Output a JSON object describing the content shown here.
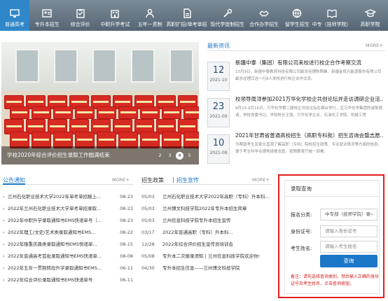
{
  "nav": {
    "items": [
      {
        "label": "普通高考",
        "icon": "monitor-icon",
        "active": true
      },
      {
        "label": "专升本招生",
        "icon": "id-card-icon"
      },
      {
        "label": "综合评价",
        "icon": "clipboard-icon"
      },
      {
        "label": "中职升学考试",
        "icon": "building-icon"
      },
      {
        "label": "五年一贯制",
        "icon": "person-icon"
      },
      {
        "label": "高职扩招/单考单招",
        "icon": "document-icon"
      },
      {
        "label": "现代学徒制招生",
        "icon": "tools-icon"
      },
      {
        "label": "合作办学招生",
        "icon": "handshake-icon"
      },
      {
        "label": "留学生招生",
        "icon": "globe-icon"
      },
      {
        "label": "中专（技师学院）",
        "icon": "book-icon"
      },
      {
        "label": "高职学院",
        "icon": "graduation-cap-icon"
      }
    ]
  },
  "banner": {
    "caption": "学校2020年综合评价招生录取工作圆满结束",
    "pages": [
      "2",
      "3",
      "4",
      "5"
    ],
    "active_page": "4"
  },
  "latest": {
    "title": "最新资讯",
    "more": "MORE+",
    "items": [
      {
        "day": "12",
        "ym": "2021-10",
        "title": "新疆中泰（集团）有限公司来校进行校企合作考察交流",
        "desc": "10月9日，新疆中泰教育科技有限公司副总经理陈照峰、新疆金辉光能源股份有限公司副总经理闫洁一行8人来校进行校企合作交流。"
      },
      {
        "day": "23",
        "ym": "2021-09",
        "title": "校领导周浔参加2021万华化学校企共创论坛并走访调研企业活...",
        "desc": "9月15-9月16日，万华化学第二届校企共创论坛在烟台举行，应万华化学集团的诚挚邀请，学校党委书记、学校校长王强、万华化学企业，石油化工学院、机械工程"
      },
      {
        "day": "10",
        "ym": "2021-08",
        "title": "2021年甘肃省普通高校招生（高职专科批）招生咨询会暨志愿...",
        "desc": "为帮助考生及家长直观了解高职（专科）院校招生政策、专业就业情况等方面的信息，便于考生科学合理地填报志愿。按照教育厅统一部署，"
      }
    ]
  },
  "notice": {
    "title": "公告通知",
    "more": "MORE+",
    "rows": [
      {
        "text": "兰州石化职业技术大学2022年单考单招报上...",
        "date": "08-23"
      },
      {
        "text": "2022年兰州石化职业技术大学单考单招录取...",
        "date": "08-23"
      },
      {
        "text": "2022年中职升学录取通知书EMS快递单号（...",
        "date": "08-23"
      },
      {
        "text": "2022年理工/文史/艺术类录取通知书EMS...",
        "date": "08-22"
      },
      {
        "text": "2022年隆重庆典类录取通知书EMS快递单...",
        "date": "08-15"
      },
      {
        "text": "2022年普通高考首批录取通知书EMS快递单...",
        "date": "08-08"
      },
      {
        "text": "2022年五年一贯制转段升学录取通知书EMS...",
        "date": "06-11"
      },
      {
        "text": "2022年综合评价录取通知书EMS快递单号",
        "date": "06-11"
      }
    ]
  },
  "policy": {
    "tab1": "招生政策",
    "tab2": "招生宣传",
    "more": "MORE+",
    "rows": [
      {
        "date": "05/03",
        "text": "兰州石化职业技术大学2022年高职（专科）升本科..."
      },
      {
        "date": "05/03",
        "text": "兰州博文科技学院2022年专升本招生简章"
      },
      {
        "date": "05/03",
        "text": "兰州信息科技学院专升本招生宣传"
      },
      {
        "date": "03/17",
        "text": "2022年普通高职（专科）升本科..."
      },
      {
        "date": "12/28",
        "text": "2022年综合评价招生宣传员培训会"
      },
      {
        "date": "05/08",
        "text": "专升本二次报录须知丨兰州信息科技学院欢迎你!"
      },
      {
        "date": "04/30",
        "text": "专升本招生信息——兰州博文科技学院"
      }
    ]
  },
  "query": {
    "title": "录取查询",
    "category_label": "报名分类:",
    "category_value": "中专部（技师学院）录",
    "id_label": "身份证号:",
    "id_placeholder": "请输入身份证号",
    "name_label": "考生姓名:",
    "name_placeholder": "请输入考生姓名",
    "button": "查询",
    "note": "备注：请先选择查询类别，然后输入正确的身份证号及考生姓名，点击查询按钮。"
  },
  "colors": {
    "accent": "#1c77c9",
    "highlight_border": "#e41e1e"
  }
}
